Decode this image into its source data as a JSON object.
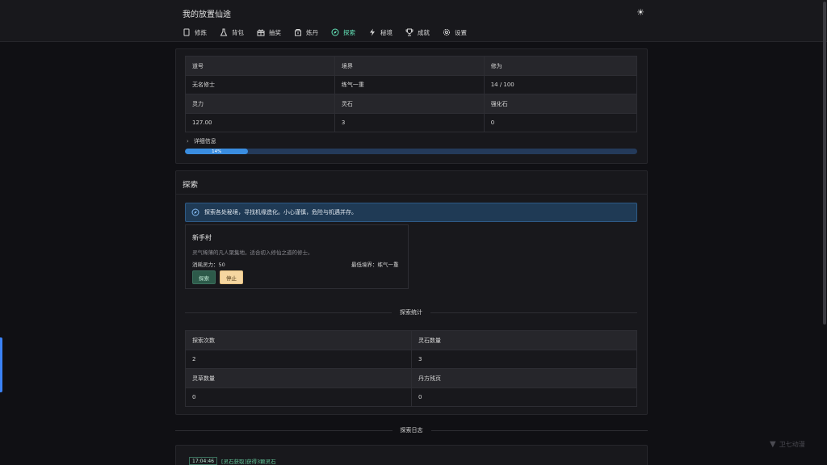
{
  "app": {
    "title": "我的放置仙途"
  },
  "nav": [
    {
      "label": "修炼",
      "icon": "book-icon"
    },
    {
      "label": "背包",
      "icon": "flask-icon"
    },
    {
      "label": "抽奖",
      "icon": "gift-icon"
    },
    {
      "label": "炼丹",
      "icon": "box-icon"
    },
    {
      "label": "探索",
      "icon": "compass-icon",
      "active": true
    },
    {
      "label": "秘境",
      "icon": "bolt-icon"
    },
    {
      "label": "成就",
      "icon": "trophy-icon"
    },
    {
      "label": "设置",
      "icon": "gear-icon"
    }
  ],
  "player": {
    "headers1": [
      "道号",
      "境界",
      "修为"
    ],
    "values1": [
      "无名修士",
      "练气一重",
      "14 / 100"
    ],
    "headers2": [
      "灵力",
      "灵石",
      "强化石"
    ],
    "values2": [
      "127.00",
      "3",
      "0"
    ],
    "detail_label": "详细信息",
    "progress_percent": 14,
    "progress_label": "14%"
  },
  "explore": {
    "title": "探索",
    "alert": "探索各处秘境，寻找机缘造化。小心谨慎，危险与机遇并存。",
    "location": {
      "name": "新手村",
      "desc": "灵气稀薄的凡人聚集地，适合初入修仙之道的修士。",
      "cost": "消耗灵力：50",
      "min_realm": "最低境界：练气一重",
      "explore_btn": "探索",
      "stop_btn": "停止"
    },
    "stats_title": "探索统计",
    "stats": {
      "headers1": [
        "探索次数",
        "灵石数量"
      ],
      "values1": [
        "2",
        "3"
      ],
      "headers2": [
        "灵草数量",
        "丹方残页"
      ],
      "values2": [
        "0",
        "0"
      ]
    },
    "log_title": "探索日志",
    "log": [
      {
        "time": "17:04:46",
        "text": "[灵石获取]获得3颗灵石"
      }
    ]
  },
  "watermark": "卫七动漫",
  "colors": {
    "accent": "#63e2b7",
    "progress": "#3a8de0",
    "alert_bg": "#1f3a55"
  }
}
